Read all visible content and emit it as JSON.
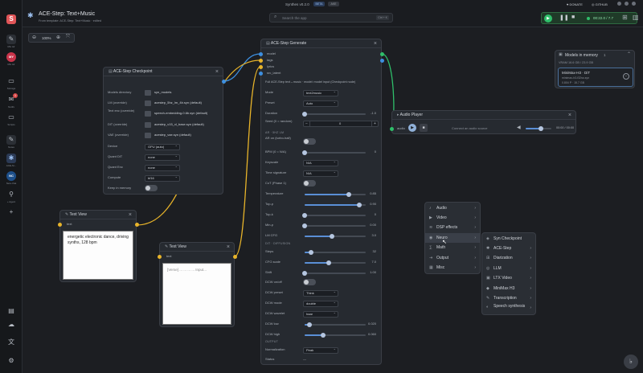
{
  "rail": {
    "items": [
      {
        "icon": "S",
        "label": ""
      },
      {
        "icon": "✎",
        "label": "Mix Air"
      },
      {
        "icon": "MY",
        "label": "Mix Air"
      },
      {
        "icon": "▭",
        "label": "Storage"
      },
      {
        "icon": "✉",
        "label": "Notifs",
        "badge": "1"
      },
      {
        "icon": "▭",
        "label": "Scripts"
      },
      {
        "icon": "✎",
        "label": "Notes"
      },
      {
        "icon": "✱",
        "label": "ACE-St..."
      },
      {
        "icon": "NC",
        "label": "New chat"
      },
      {
        "icon": "⚲",
        "label": "+ Agent"
      },
      {
        "icon": "+",
        "label": ""
      }
    ],
    "bottom": [
      "▤",
      "☁",
      "文",
      "⚙"
    ]
  },
  "header": {
    "title": "ACE-Step: Text+Music",
    "subtitle": "From template: ACE-Step: Text+Music · edited",
    "app_name": "Synthes v0.2.0",
    "beta": "BETA",
    "extra": "AKE",
    "search_placeholder": "Search the app",
    "search_shortcut": "Ctrl + K",
    "donate": "DONATE",
    "github": "GITHUB",
    "timer": "00:22.0 / 7.7"
  },
  "zoom": {
    "level": "100%"
  },
  "memory": {
    "title": "Models in memory",
    "count": "1",
    "vram": "VRAM 16.6 GB / 23.9 GB",
    "model_name": "MiniMax-H3 · DiT",
    "model_file": "minimax-h3-f32ss.syn",
    "model_meta": "0.804 P · 15.7 GB"
  },
  "checkpoint": {
    "title": "ACE-Step Checkpoint",
    "rows": [
      {
        "label": "Models directory",
        "value": "syn_models"
      },
      {
        "label": "LM (override)",
        "value": "acestep_5hz_lm_4b.syn (default)"
      },
      {
        "label": "Text enc (override)",
        "value": "speech-embedding-0.6b.syn (default)"
      },
      {
        "label": "DiT (override)",
        "value": "acestep_v15_xl_base.syn (default)"
      },
      {
        "label": "VAE (override)",
        "value": "acestep_vae.syn (default)"
      }
    ],
    "device_label": "Device",
    "device": "GPU (auto)",
    "quantdit_label": "Quant DiT",
    "quantdit": "none",
    "quantenc_label": "Quant Enc",
    "quantenc": "none",
    "compute_label": "Compute",
    "compute": "bf16",
    "keep_label": "Keep in memory"
  },
  "textview1": {
    "title": "Text View",
    "port": "text",
    "text": "energetic electronic dance, driving synths, 128 bpm"
  },
  "textview2": {
    "title": "Text View",
    "port": "text",
    "text": "[Verse] ... ... ... ... Input..."
  },
  "generate": {
    "title": "ACE-Step Generate",
    "ports": [
      "model",
      "tags",
      "lyrics",
      "src_latent"
    ],
    "desc": "Full ACE-Step text→music · model: model input (Checkpoint node)",
    "mode_label": "Mode",
    "mode": "text2music",
    "preset_label": "Preset",
    "preset": "Auto",
    "duration_label": "Duration",
    "duration": "-1.0",
    "seed_label": "Seed (0 = random)",
    "seed": "0",
    "sec_lm": "AR · 5HZ LM",
    "ar_label": "AR on (turbo-half)",
    "bpm_label": "BPM (0 = N/A)",
    "bpm": "0",
    "key_label": "Keyscale",
    "key": "N/A",
    "ts_label": "Time signature",
    "ts": "N/A",
    "cot_label": "CoT (Phase 1)",
    "temp_label": "Temperature",
    "temp": "0.85",
    "topp_label": "Top-p",
    "topp": "0.90",
    "topk_label": "Top-k",
    "topk": "0",
    "minp_label": "Min-p",
    "minp": "0.00",
    "lmcfg_label": "LM CFG",
    "lmcfg": "3.0",
    "sec_dit": "DIT · DIFFUSION",
    "steps_label": "Steps",
    "steps": "32",
    "cfg_label": "CFG scale",
    "cfg": "7.0",
    "shift_label": "Shift",
    "shift": "1.00",
    "dcwon_label": "DCW on/off",
    "dcwp_label": "DCW preset",
    "dcwp": "Think",
    "dcwm_label": "DCW mode",
    "dcwm": "double",
    "dcwwav_label": "DCW wavelet",
    "dcwwav": "haar",
    "dcwlow_label": "DCW low",
    "dcwlow": "0.020",
    "dcwhigh_label": "DCW high",
    "dcwhigh": "0.060",
    "sec_out": "OUTPUT",
    "norm_label": "Normalization",
    "norm": "Peak",
    "status_label": "Status",
    "status": "—"
  },
  "player": {
    "title": "Audio Player",
    "port": "audio",
    "source": "Connect an audio source",
    "time": "00:00 / 00:00",
    "volume": 0.6
  },
  "menu": {
    "main": [
      {
        "icon": "♪",
        "label": "Audio"
      },
      {
        "icon": "▶",
        "label": "Video"
      },
      {
        "icon": "≋",
        "label": "DSP effects"
      },
      {
        "icon": "◉",
        "label": "Neuro"
      },
      {
        "icon": "∑",
        "label": "Math"
      },
      {
        "icon": "⇥",
        "label": "Output"
      },
      {
        "icon": "▦",
        "label": "Misc"
      }
    ],
    "sub": [
      {
        "icon": "◈",
        "label": "Syn Checkpoint"
      },
      {
        "icon": "✱",
        "label": "ACE-Step"
      },
      {
        "icon": "⊞",
        "label": "Diarization"
      },
      {
        "icon": "◎",
        "label": "LLM"
      },
      {
        "icon": "▣",
        "label": "LTX Video"
      },
      {
        "icon": "◆",
        "label": "MiniMax H3"
      },
      {
        "icon": "✎",
        "label": "Transcription"
      },
      {
        "icon": "◐",
        "label": "Speech synthesis"
      }
    ]
  },
  "colors": {
    "accent": "#5a8fd6",
    "wire_yellow": "#e8b42a",
    "wire_green": "#2fbf6a",
    "wire_blue": "#3d8fe0"
  }
}
